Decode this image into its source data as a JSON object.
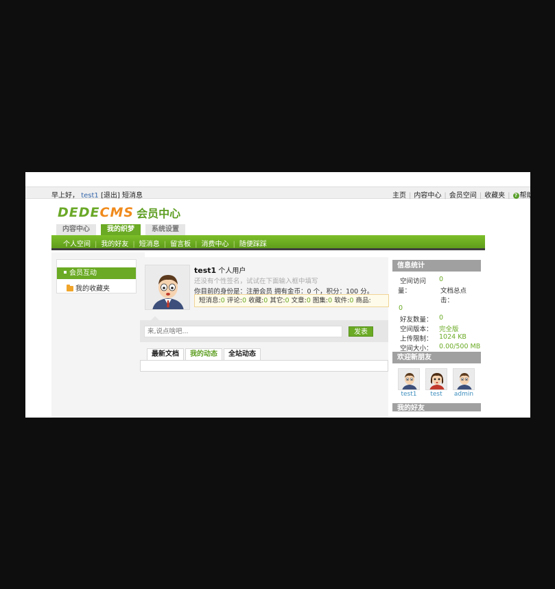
{
  "topbar": {
    "greeting": "早上好，",
    "username": "test1",
    "logout": "[退出]",
    "messages": "短消息",
    "links": [
      "主页",
      "内容中心",
      "会员空间",
      "收藏夹"
    ],
    "help": "帮助"
  },
  "logo": {
    "brand_a": "DEDE",
    "brand_b": "CMS",
    "subtitle": "会员中心"
  },
  "main_tabs": [
    "内容中心",
    "我的织梦",
    "系统设置"
  ],
  "sub_nav": [
    "个人空间",
    "我的好友",
    "短消息",
    "留言板",
    "消费中心",
    "随便踩踩"
  ],
  "left_menu": {
    "active": "会员互动",
    "favorites": "我的收藏夹"
  },
  "profile": {
    "name": "test1",
    "type": "个人用户",
    "signature_hint": "还没有个性签名，试试在下面输入框中填写",
    "role_line": "你目前的身份是：注册会员 拥有金币：0 个，积分：100 分。",
    "stats": {
      "labels": [
        "短消息:",
        "评论:",
        "收藏:",
        "其它:",
        "文章:",
        "图集:",
        "软件:",
        "商品:"
      ],
      "values": [
        "0",
        "0",
        "0",
        "0",
        "0",
        "0",
        "0",
        ""
      ]
    }
  },
  "post": {
    "placeholder": "来,说点啥吧...",
    "submit": "发表"
  },
  "feed_tabs": [
    "最新文档",
    "我的动态",
    "全站动态"
  ],
  "info_panel": {
    "title": "信息统计",
    "visits_label_1": "空间访问",
    "visits_label_2": "量：",
    "visits_value": "0",
    "docs_label_1": "文档总点",
    "docs_label_2": "击：",
    "docs_value": "0",
    "friends_label": "好友数量：",
    "friends_value": "0",
    "version_label": "空间版本：",
    "version_value": "完全版",
    "upload_label": "上传限制：",
    "upload_value": "1024 KB",
    "size_label": "空间大小：",
    "size_value": "0.00/500 MB"
  },
  "new_friends": {
    "title": "欢迎新朋友",
    "names": [
      "test1",
      "test",
      "admin"
    ]
  },
  "my_friends": {
    "title": "我的好友"
  },
  "colors": {
    "brand_green": "#6aaa24",
    "brand_orange": "#f08a1c",
    "link_blue": "#3b8dbd"
  }
}
